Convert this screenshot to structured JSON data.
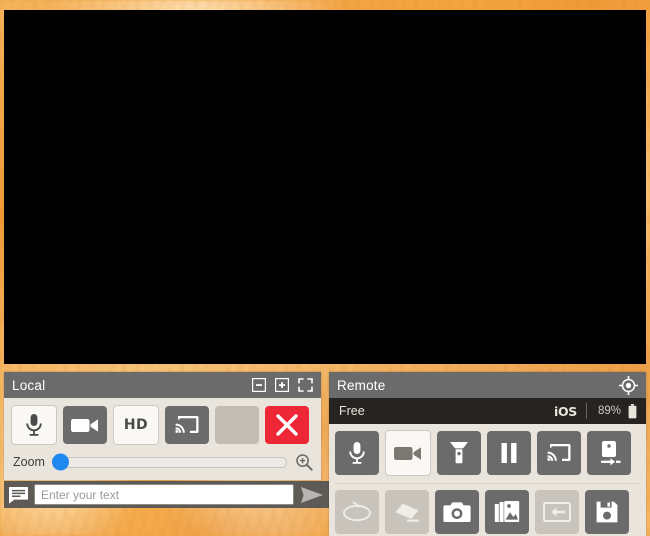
{
  "app": {
    "background_color": "#f0a23c",
    "video_area_color": "#000000"
  },
  "local": {
    "title": "Local",
    "header_icons": [
      {
        "name": "minimize-icon",
        "label": "Minimize"
      },
      {
        "name": "maximize-icon",
        "label": "Maximize"
      },
      {
        "name": "fullscreen-icon",
        "label": "Fullscreen"
      }
    ],
    "buttons": [
      {
        "name": "microphone-button",
        "label": "Microphone",
        "state": "on"
      },
      {
        "name": "video-camera-button",
        "label": "Video camera",
        "state": "off"
      },
      {
        "name": "hd-button",
        "label": "HD",
        "text": "HD",
        "state": "on"
      },
      {
        "name": "cast-button",
        "label": "Cast",
        "state": "off"
      },
      {
        "name": "blank-button",
        "label": "",
        "state": "disabled"
      },
      {
        "name": "close-call-button",
        "label": "End call",
        "state": "danger"
      }
    ],
    "zoom": {
      "label": "Zoom",
      "value": 0,
      "min": 0,
      "max": 100,
      "icon": "magnifier-plus-icon"
    }
  },
  "chat": {
    "icon": "chat-bubble-icon",
    "placeholder": "Enter your text",
    "value": "",
    "send_icon": "send-arrow-icon"
  },
  "remote": {
    "title": "Remote",
    "header_icon": {
      "name": "target-locate-icon",
      "label": "Locate"
    },
    "status": {
      "label": "Free",
      "os": "iOS",
      "battery_percent": "89%",
      "battery_icon": "battery-icon"
    },
    "buttons_row1": [
      {
        "name": "microphone-button",
        "label": "Microphone",
        "state": "off"
      },
      {
        "name": "video-camera-button",
        "label": "Video camera",
        "state": "on"
      },
      {
        "name": "flashlight-button",
        "label": "Flashlight",
        "state": "off"
      },
      {
        "name": "pause-button",
        "label": "Pause",
        "state": "off"
      },
      {
        "name": "cast-button",
        "label": "Cast",
        "state": "off"
      },
      {
        "name": "switch-device-button",
        "label": "Switch device",
        "state": "off"
      }
    ],
    "buttons_row2": [
      {
        "name": "lasso-annotate-button",
        "label": "Lasso",
        "state": "disabled"
      },
      {
        "name": "eraser-button",
        "label": "Eraser",
        "state": "disabled"
      },
      {
        "name": "photo-capture-button",
        "label": "Take photo",
        "state": "off"
      },
      {
        "name": "gallery-button",
        "label": "Gallery",
        "state": "off"
      },
      {
        "name": "send-to-screen-button",
        "label": "Send to screen",
        "state": "disabled"
      },
      {
        "name": "save-button",
        "label": "Save",
        "state": "off"
      }
    ]
  }
}
